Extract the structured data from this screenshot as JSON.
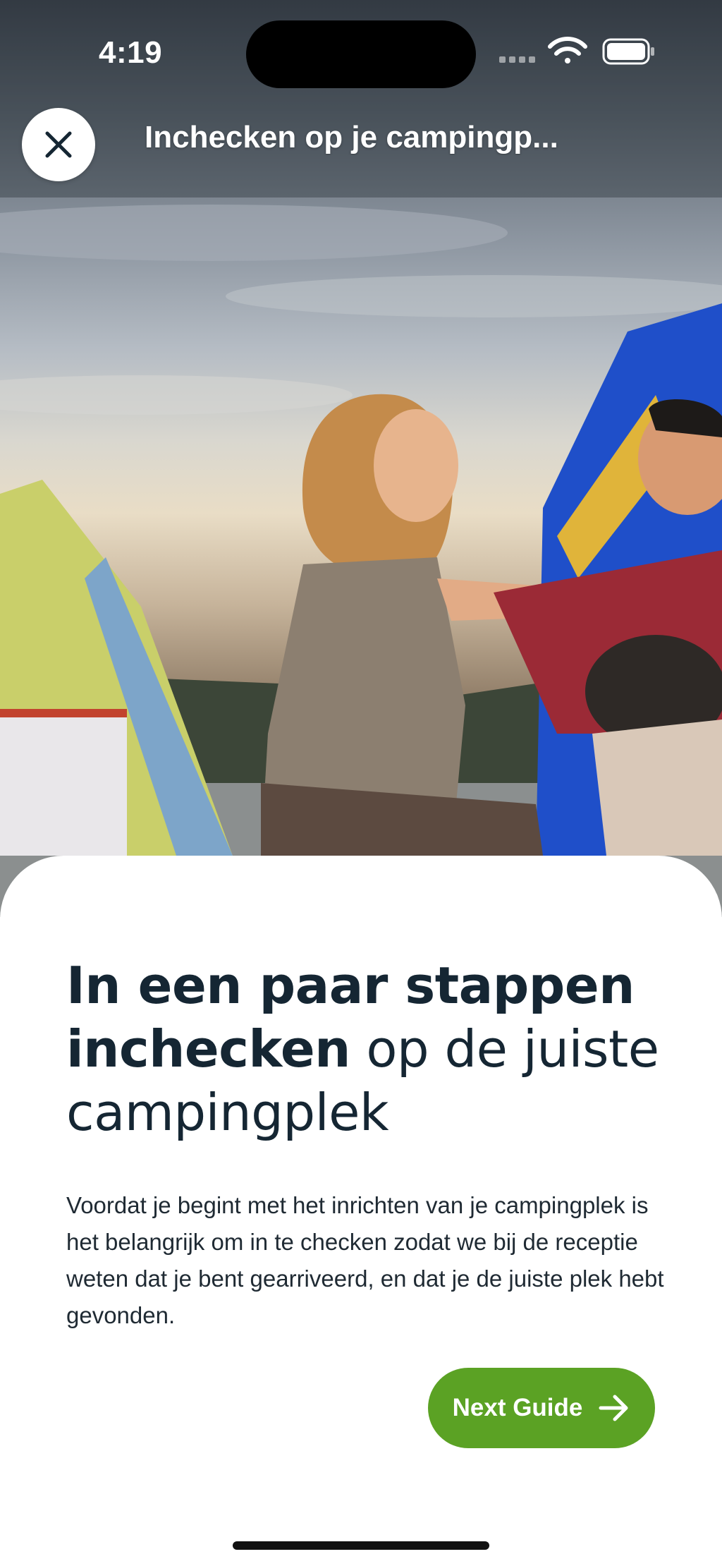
{
  "status_bar": {
    "time": "4:19"
  },
  "nav": {
    "title": "Inchecken op je campingp..."
  },
  "hero": {
    "image_description": "couple camping photo"
  },
  "content": {
    "headline_bold_1": "In een paar stappen",
    "headline_bold_2": "inchecken",
    "headline_light_1": " op de juiste",
    "headline_light_2": "campingplek",
    "body": "Voordat je begint met het inrichten van je campingplek is het belangrijk om in te checken zodat we bij de receptie weten dat je bent gearriveerd, en dat je de juiste plek hebt gevonden."
  },
  "actions": {
    "next_label": "Next Guide"
  },
  "colors": {
    "accent": "#5ba224",
    "text_dark": "#152633"
  },
  "icons": [
    "close-icon",
    "arrow-right-icon",
    "wifi-icon",
    "battery-icon",
    "signal-icon"
  ]
}
